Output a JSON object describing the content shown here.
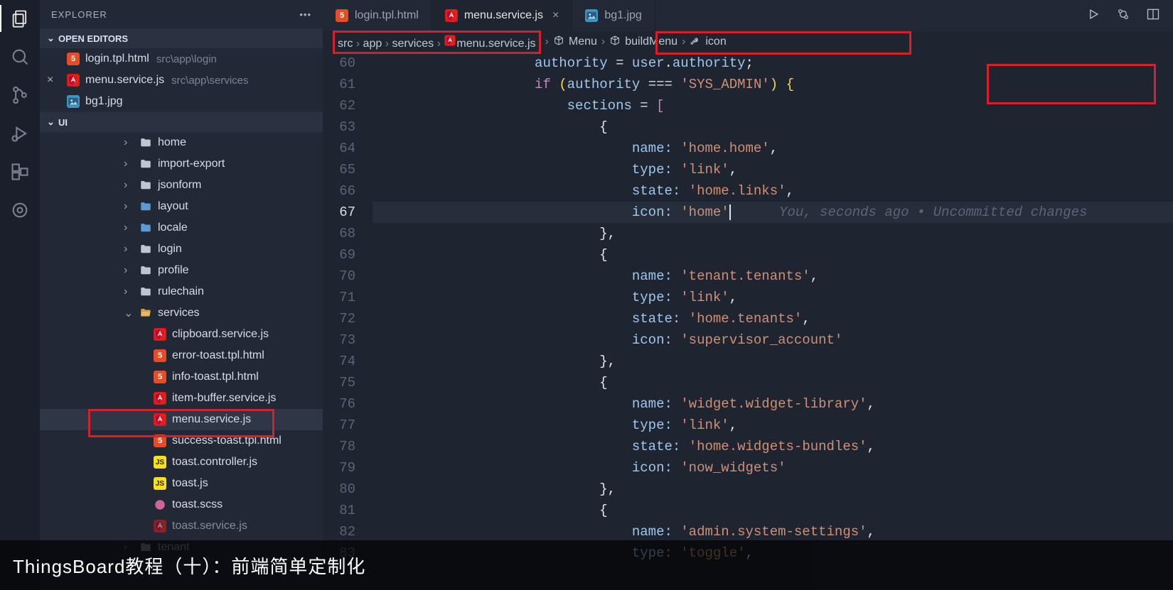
{
  "sidebar": {
    "title": "EXPLORER",
    "sections": {
      "openEditors": "OPEN EDITORS",
      "root": "UI"
    },
    "openEditors": [
      {
        "icon": "html5",
        "name": "login.tpl.html",
        "path": "src\\app\\login",
        "close": ""
      },
      {
        "icon": "ang",
        "name": "menu.service.js",
        "path": "src\\app\\services",
        "close": "×"
      },
      {
        "icon": "img",
        "name": "bg1.jpg",
        "path": "",
        "close": ""
      }
    ],
    "tree": [
      {
        "depth": 1,
        "chev": "›",
        "icon": "folder",
        "name": "home"
      },
      {
        "depth": 1,
        "chev": "›",
        "icon": "folder",
        "name": "import-export"
      },
      {
        "depth": 1,
        "chev": "›",
        "icon": "folder",
        "name": "jsonform"
      },
      {
        "depth": 1,
        "chev": "›",
        "icon": "folderblue",
        "name": "layout"
      },
      {
        "depth": 1,
        "chev": "›",
        "icon": "folderblue",
        "name": "locale"
      },
      {
        "depth": 1,
        "chev": "›",
        "icon": "folder",
        "name": "login"
      },
      {
        "depth": 1,
        "chev": "›",
        "icon": "folder",
        "name": "profile"
      },
      {
        "depth": 1,
        "chev": "›",
        "icon": "folder",
        "name": "rulechain"
      },
      {
        "depth": 1,
        "chev": "⌄",
        "icon": "folderopen",
        "name": "services"
      },
      {
        "depth": 2,
        "chev": "",
        "icon": "ang",
        "name": "clipboard.service.js"
      },
      {
        "depth": 2,
        "chev": "",
        "icon": "html5",
        "name": "error-toast.tpl.html"
      },
      {
        "depth": 2,
        "chev": "",
        "icon": "html5",
        "name": "info-toast.tpl.html"
      },
      {
        "depth": 2,
        "chev": "",
        "icon": "ang",
        "name": "item-buffer.service.js"
      },
      {
        "depth": 2,
        "chev": "",
        "icon": "ang",
        "name": "menu.service.js",
        "selected": true
      },
      {
        "depth": 2,
        "chev": "",
        "icon": "html5",
        "name": "success-toast.tpl.html"
      },
      {
        "depth": 2,
        "chev": "",
        "icon": "js",
        "name": "toast.controller.js"
      },
      {
        "depth": 2,
        "chev": "",
        "icon": "js",
        "name": "toast.js"
      },
      {
        "depth": 2,
        "chev": "",
        "icon": "scss",
        "name": "toast.scss"
      },
      {
        "depth": 2,
        "chev": "",
        "icon": "ang",
        "name": "toast.service.js",
        "dim": true
      },
      {
        "depth": 1,
        "chev": "›",
        "icon": "folder",
        "name": "tenant",
        "dim": true
      }
    ]
  },
  "tabs": [
    {
      "icon": "html5",
      "label": "login.tpl.html",
      "active": false
    },
    {
      "icon": "ang",
      "label": "menu.service.js",
      "active": true,
      "close": "×"
    },
    {
      "icon": "img",
      "label": "bg1.jpg",
      "active": false
    }
  ],
  "breadcrumb": {
    "parts": [
      "src",
      "app",
      "services",
      "menu.service.js",
      "Menu",
      "buildMenu",
      "icon"
    ]
  },
  "code": {
    "startLine": 60,
    "currentLine": 67,
    "gitlens": "You, seconds ago • Uncommitted changes",
    "lines": [
      {
        "n": 60,
        "html": "                    <span class='var'>authority</span> <span class='op'>=</span> <span class='var'>user</span><span class='pun'>.</span><span class='var'>authority</span><span class='pun'>;</span>"
      },
      {
        "n": 61,
        "html": "                    <span class='kw'>if</span> <span class='pun2'>(</span><span class='var'>authority</span> <span class='op'>===</span> <span class='str'>'SYS_ADMIN'</span><span class='pun2'>)</span> <span class='pun2'>{</span>"
      },
      {
        "n": 62,
        "html": "                        <span class='var'>sections</span> <span class='op'>=</span> <span class='pun3'>[</span>"
      },
      {
        "n": 63,
        "html": "                            <span class='pun'>{</span>"
      },
      {
        "n": 64,
        "html": "                                <span class='prop'>name:</span> <span class='str'>'home.home'</span><span class='pun'>,</span>"
      },
      {
        "n": 65,
        "html": "                                <span class='prop'>type:</span> <span class='str'>'link'</span><span class='pun'>,</span>"
      },
      {
        "n": 66,
        "html": "                                <span class='prop'>state:</span> <span class='str'>'home.links'</span><span class='pun'>,</span>"
      },
      {
        "n": 67,
        "html": "                                <span class='prop'>icon:</span> <span class='str'>'home'</span><span class='cursor'></span>"
      },
      {
        "n": 68,
        "html": "                            <span class='pun'>},</span>"
      },
      {
        "n": 69,
        "html": "                            <span class='pun'>{</span>"
      },
      {
        "n": 70,
        "html": "                                <span class='prop'>name:</span> <span class='str'>'tenant.tenants'</span><span class='pun'>,</span>"
      },
      {
        "n": 71,
        "html": "                                <span class='prop'>type:</span> <span class='str'>'link'</span><span class='pun'>,</span>"
      },
      {
        "n": 72,
        "html": "                                <span class='prop'>state:</span> <span class='str'>'home.tenants'</span><span class='pun'>,</span>"
      },
      {
        "n": 73,
        "html": "                                <span class='prop'>icon:</span> <span class='str'>'supervisor_account'</span>"
      },
      {
        "n": 74,
        "html": "                            <span class='pun'>},</span>"
      },
      {
        "n": 75,
        "html": "                            <span class='pun'>{</span>"
      },
      {
        "n": 76,
        "html": "                                <span class='prop'>name:</span> <span class='str'>'widget.widget-library'</span><span class='pun'>,</span>"
      },
      {
        "n": 77,
        "html": "                                <span class='prop'>type:</span> <span class='str'>'link'</span><span class='pun'>,</span>"
      },
      {
        "n": 78,
        "html": "                                <span class='prop'>state:</span> <span class='str'>'home.widgets-bundles'</span><span class='pun'>,</span>"
      },
      {
        "n": 79,
        "html": "                                <span class='prop'>icon:</span> <span class='str'>'now_widgets'</span>"
      },
      {
        "n": 80,
        "html": "                            <span class='pun'>},</span>"
      },
      {
        "n": 81,
        "html": "                            <span class='pun'>{</span>"
      },
      {
        "n": 82,
        "html": "                                <span class='prop'>name:</span> <span class='str'>'admin.system-settings'</span><span class='pun'>,</span>"
      },
      {
        "n": 83,
        "html": "                                <span class='prop'>type:</span> <span class='str'>'toggle'</span><span class='pun'>,</span>"
      }
    ]
  },
  "caption": "ThingsBoard教程（十）：前端简单定制化"
}
